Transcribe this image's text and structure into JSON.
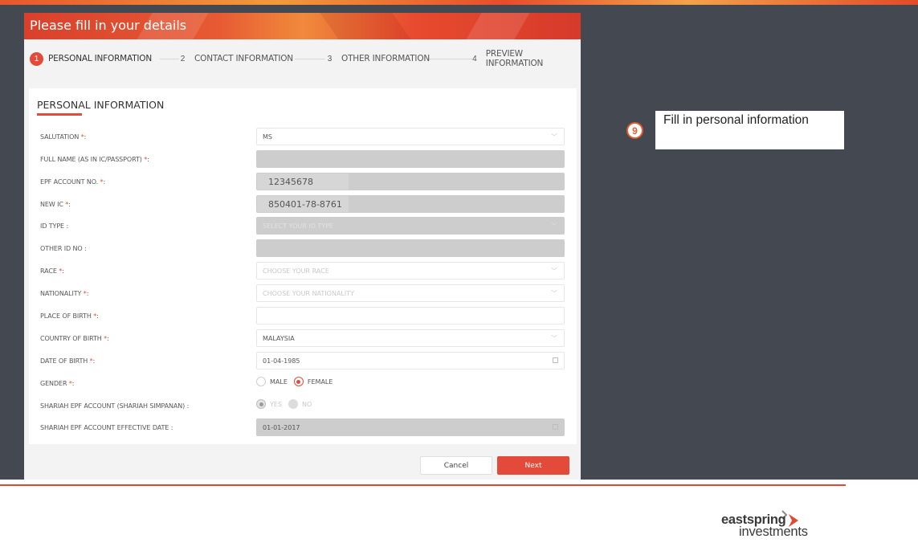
{
  "modal": {
    "title": "Please fill in your details"
  },
  "stepper": [
    {
      "num": "1",
      "label": "PERSONAL INFORMATION"
    },
    {
      "num": "2",
      "label": "CONTACT INFORMATION"
    },
    {
      "num": "3",
      "label": "OTHER INFORMATION"
    },
    {
      "num": "4",
      "label": "PREVIEW INFORMATION"
    }
  ],
  "form": {
    "section_title": "PERSONAL INFORMATION",
    "required_mark": "*",
    "fields": [
      {
        "label": "SALUTATION ",
        "colon": ":",
        "value": "MS",
        "placeholder": ""
      },
      {
        "label": "FULL NAME (AS IN IC/PASSPORT) ",
        "colon": ":",
        "value": "",
        "placeholder": ""
      },
      {
        "label": "EPF ACCOUNT NO. ",
        "colon": ":",
        "value": "12345678",
        "placeholder": ""
      },
      {
        "label": "NEW IC ",
        "colon": ":",
        "value": "850401-78-8761",
        "placeholder": ""
      },
      {
        "label": "ID TYPE ",
        "colon": ":",
        "value": "",
        "placeholder": "SELECT YOUR ID TYPE"
      },
      {
        "label": "OTHER ID NO ",
        "colon": ":",
        "value": "",
        "placeholder": ""
      },
      {
        "label": "RACE ",
        "colon": ":",
        "value": "",
        "placeholder": "CHOOSE YOUR RACE"
      },
      {
        "label": "NATIONALITY ",
        "colon": ":",
        "value": "",
        "placeholder": "CHOOSE YOUR NATIONALITY"
      },
      {
        "label": "PLACE OF BIRTH ",
        "colon": ":",
        "value": "",
        "placeholder": ""
      },
      {
        "label": "COUNTRY OF BIRTH ",
        "colon": ":",
        "value": "MALAYSIA",
        "placeholder": ""
      },
      {
        "label": "DATE OF BIRTH ",
        "colon": ":",
        "value": "01-04-1985",
        "placeholder": ""
      },
      {
        "label": "GENDER ",
        "colon": ":",
        "options": [
          "MALE",
          "FEMALE"
        ],
        "selected": "FEMALE"
      },
      {
        "label": "SHARIAH EPF ACCOUNT (SHARIAH SIMPANAN) ",
        "colon": ":",
        "options": [
          "YES",
          "NO"
        ],
        "selected": "YES"
      },
      {
        "label": "SHARIAH EPF ACCOUNT EFFECTIVE DATE ",
        "colon": ":",
        "value": "01-01-2017",
        "placeholder": ""
      }
    ]
  },
  "buttons": {
    "cancel": "Cancel",
    "next": "Next"
  },
  "callout": {
    "number": "9",
    "text": "Fill in personal information"
  },
  "logo": {
    "line1": "eastspring",
    "line2": "investments"
  },
  "colors": {
    "accent": "#e34a3a",
    "stage": "#444850"
  }
}
